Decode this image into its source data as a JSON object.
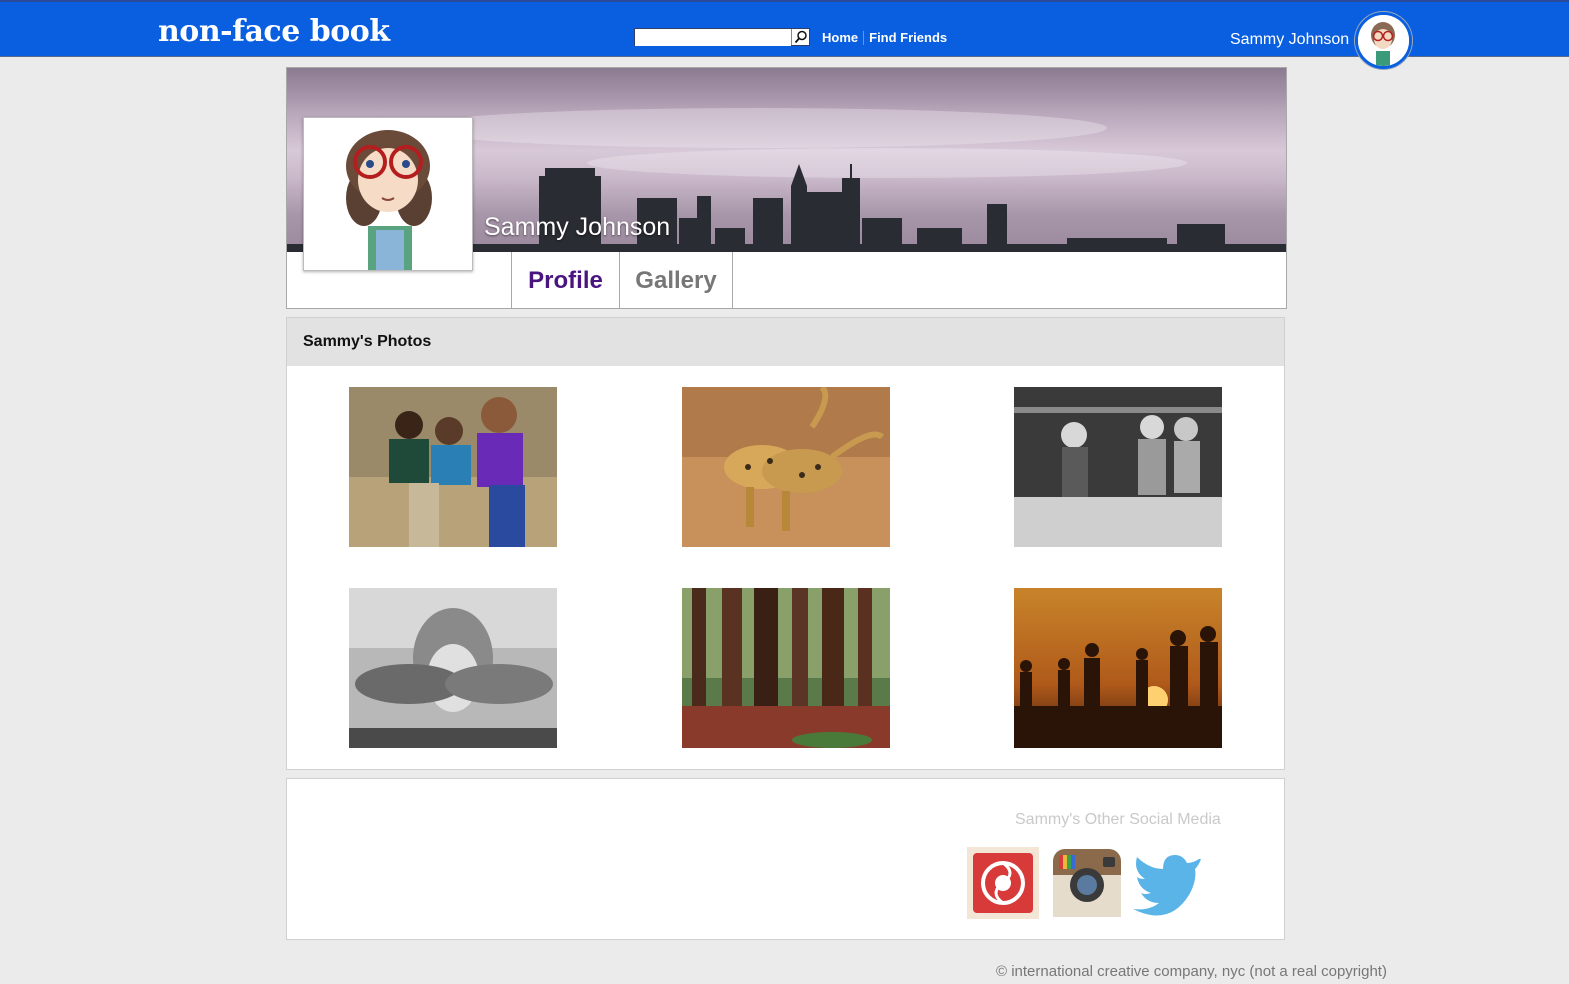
{
  "topbar": {
    "logo": "non-face book",
    "search_placeholder": "",
    "nav": {
      "home": "Home",
      "find_friends": "Find Friends"
    },
    "user_name": "Sammy Johnson",
    "brand_color": "#0a5fe0"
  },
  "profile": {
    "name": "Sammy Johnson",
    "tabs": [
      {
        "label": "Profile"
      },
      {
        "label": "Gallery"
      }
    ]
  },
  "photos": {
    "heading": "Sammy's Photos",
    "items": [
      {
        "icon": "children-running-photo"
      },
      {
        "icon": "leopards-photo"
      },
      {
        "icon": "kids-jumping-pool-photo"
      },
      {
        "icon": "girl-with-fish-photo"
      },
      {
        "icon": "redwood-forest-photo"
      },
      {
        "icon": "family-silhouette-sunset-photo"
      }
    ]
  },
  "social": {
    "heading": "Sammy's Other Social Media",
    "icons": [
      "spiral-social-icon",
      "instagram-icon",
      "twitter-icon"
    ]
  },
  "footer": {
    "copyright": "© international creative company, nyc (not a real copyright)"
  }
}
